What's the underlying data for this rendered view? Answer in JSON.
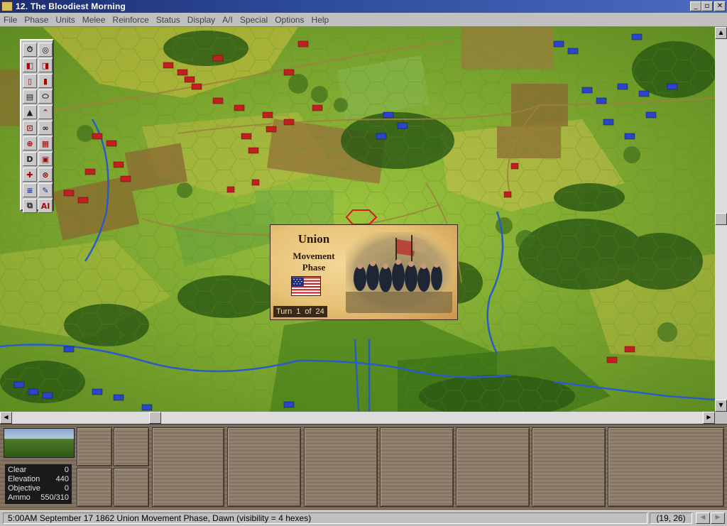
{
  "window": {
    "title": "12. The Bloodiest Morning",
    "minimize": "_",
    "maximize": "▫",
    "close": "✕"
  },
  "menu": [
    {
      "label": "File"
    },
    {
      "label": "Phase"
    },
    {
      "label": "Units"
    },
    {
      "label": "Melee"
    },
    {
      "label": "Reinforce"
    },
    {
      "label": "Status"
    },
    {
      "label": "Display"
    },
    {
      "label": "A/I"
    },
    {
      "label": "Special"
    },
    {
      "label": "Options"
    },
    {
      "label": "Help"
    }
  ],
  "toolbar": {
    "ai_label": "AI",
    "d_label": "D"
  },
  "phase_dialog": {
    "faction": "Union",
    "phase_line1": "Movement",
    "phase_line2": "Phase",
    "turn_label": "Turn",
    "turn_current": "1",
    "turn_of": "of",
    "turn_total": "24"
  },
  "terrain_info": {
    "rows": [
      {
        "label": "Clear",
        "value": "0"
      },
      {
        "label": "Elevation",
        "value": "440"
      },
      {
        "label": "Objective",
        "value": "0"
      },
      {
        "label": "Ammo",
        "value": "550/310"
      }
    ]
  },
  "statusbar": {
    "text": "5:00AM September 17 1862 Union Movement Phase, Dawn (visibility = 4 hexes)",
    "coords": "(19, 26)"
  },
  "colors": {
    "union": "#2a45c8",
    "confederate": "#c02020",
    "grass": "#7fa830",
    "river": "#2a5cc8"
  }
}
